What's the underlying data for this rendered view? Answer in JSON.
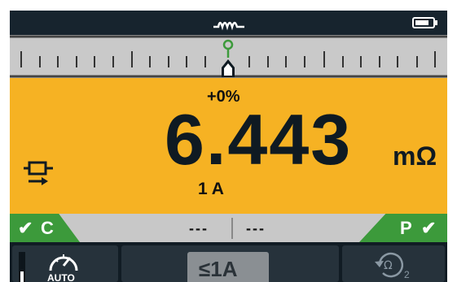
{
  "header": {
    "coil_icon": "coil-icon",
    "battery_icon": "battery-icon"
  },
  "scale": {
    "marker_icon": "pointer-marker-icon"
  },
  "measurement": {
    "deviation": "+0%",
    "value": "6.443",
    "unit": "mΩ",
    "test_current": "1 A"
  },
  "status": {
    "left_check_label": "C",
    "right_check_label": "P",
    "left_value": "---",
    "right_value": "---"
  },
  "controls": {
    "auto_label": "AUTO",
    "range_label": "≤1A",
    "cycle_subscript": "2"
  },
  "colors": {
    "accent_yellow": "#f6b223",
    "status_green": "#3c9a3b",
    "screen_bg": "#0f1a22"
  }
}
